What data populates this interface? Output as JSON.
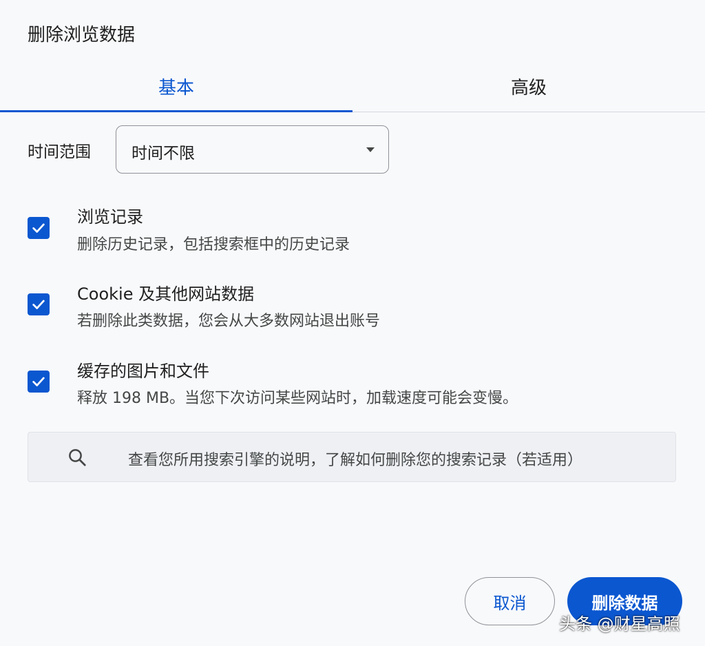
{
  "dialog": {
    "title": "删除浏览数据"
  },
  "tabs": [
    {
      "label": "基本",
      "active": true
    },
    {
      "label": "高级",
      "active": false
    }
  ],
  "time_range": {
    "label": "时间范围",
    "selected": "时间不限"
  },
  "options": [
    {
      "title": "浏览记录",
      "description": "删除历史记录，包括搜索框中的历史记录",
      "checked": true
    },
    {
      "title": "Cookie 及其他网站数据",
      "description": "若删除此类数据，您会从大多数网站退出账号",
      "checked": true
    },
    {
      "title": "缓存的图片和文件",
      "description": "释放 198 MB。当您下次访问某些网站时，加载速度可能会变慢。",
      "checked": true
    }
  ],
  "search_info": {
    "icon": "search-icon",
    "text": "查看您所用搜索引擎的说明，了解如何删除您的搜索记录（若适用）"
  },
  "buttons": {
    "cancel": "取消",
    "delete": "删除数据"
  },
  "watermark": "头条 @财星高照",
  "colors": {
    "accent": "#0b57d0",
    "background": "#f8f9fb"
  }
}
